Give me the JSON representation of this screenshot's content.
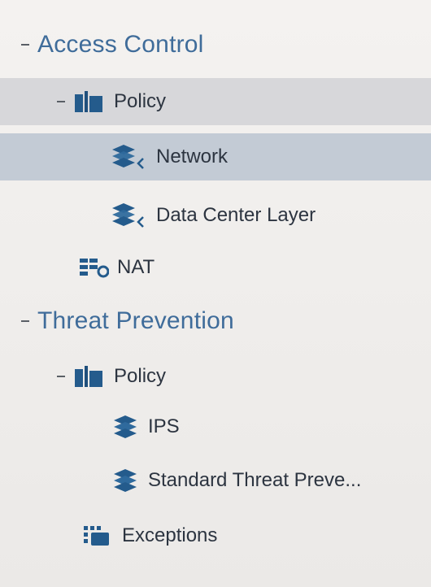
{
  "tree": {
    "access_control": {
      "label": "Access Control",
      "expanded": true,
      "policy": {
        "label": "Policy",
        "expanded": true,
        "layers": [
          {
            "label": "Network",
            "icon": "layers-icon",
            "selected": true
          },
          {
            "label": "Data Center Layer",
            "icon": "layers-icon",
            "selected": false
          }
        ]
      },
      "nat": {
        "label": "NAT",
        "icon": "nat-icon"
      }
    },
    "threat_prevention": {
      "label": "Threat Prevention",
      "expanded": true,
      "policy": {
        "label": "Policy",
        "expanded": true,
        "layers": [
          {
            "label": "IPS",
            "icon": "layers-icon"
          },
          {
            "label": "Standard Threat Preve...",
            "icon": "layers-icon"
          }
        ]
      },
      "exceptions": {
        "label": "Exceptions",
        "icon": "exceptions-icon"
      }
    }
  },
  "colors": {
    "section_text": "#3f6c9a",
    "icon_blue": "#245b8c",
    "selected_row": "#c3cbd5",
    "selected_parent_row": "#d7d7da"
  }
}
